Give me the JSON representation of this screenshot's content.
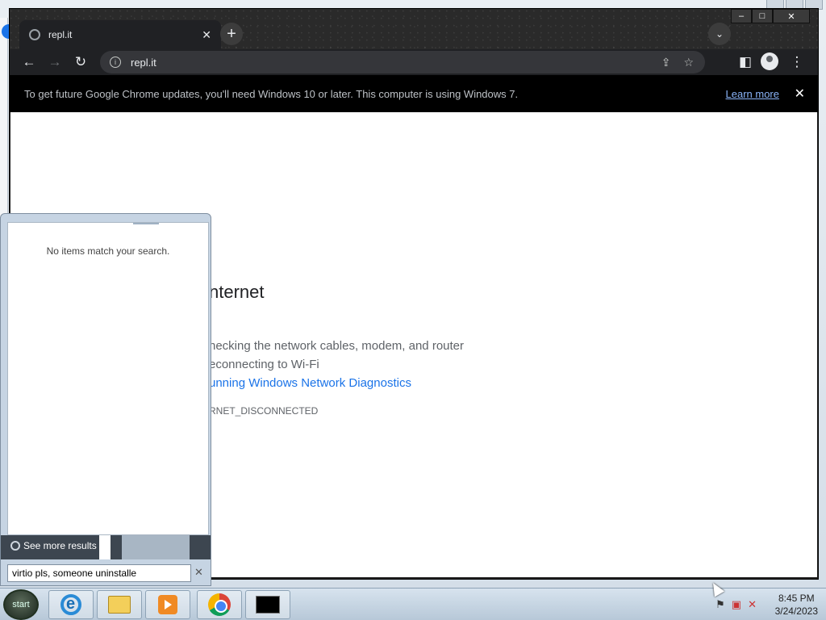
{
  "browser": {
    "tab_title": "repl.it",
    "tab_close": "✕",
    "new_tab": "+",
    "tab_search": "⌄",
    "window_controls": {
      "minimize": "–",
      "maximize": "□",
      "close": "✕"
    },
    "nav": {
      "back": "←",
      "forward": "→",
      "reload": "↻"
    },
    "url": "repl.it",
    "site_info_icon": "i",
    "share_icon": "⇪",
    "bookmark_icon": "☆",
    "menu_icon": "⋮",
    "side_panel_icon": "◧"
  },
  "infobar": {
    "message": "To get future Google Chrome updates, you'll need Windows 10 or later. This computer is using Windows 7.",
    "learn_more": "Learn more",
    "close": "✕"
  },
  "error_page": {
    "title": "nternet",
    "items": [
      "hecking the network cables, modem, and router",
      "econnecting to Wi-Fi"
    ],
    "link": "unning Windows Network Diagnostics",
    "code": "RNET_DISCONNECTED"
  },
  "start_menu": {
    "no_items": "No items match your search.",
    "see_more": "See more results",
    "search_value": "virtio pls, someone uninstalle",
    "search_clear": "✕"
  },
  "taskbar": {
    "start_label": "start",
    "items": [
      "internet-explorer",
      "file-explorer",
      "media-player",
      "chrome",
      "command-prompt"
    ],
    "tray_icons": [
      "flag-icon",
      "network-icon",
      "volume-muted-icon"
    ],
    "time": "8:45 PM",
    "date": "3/24/2023"
  }
}
